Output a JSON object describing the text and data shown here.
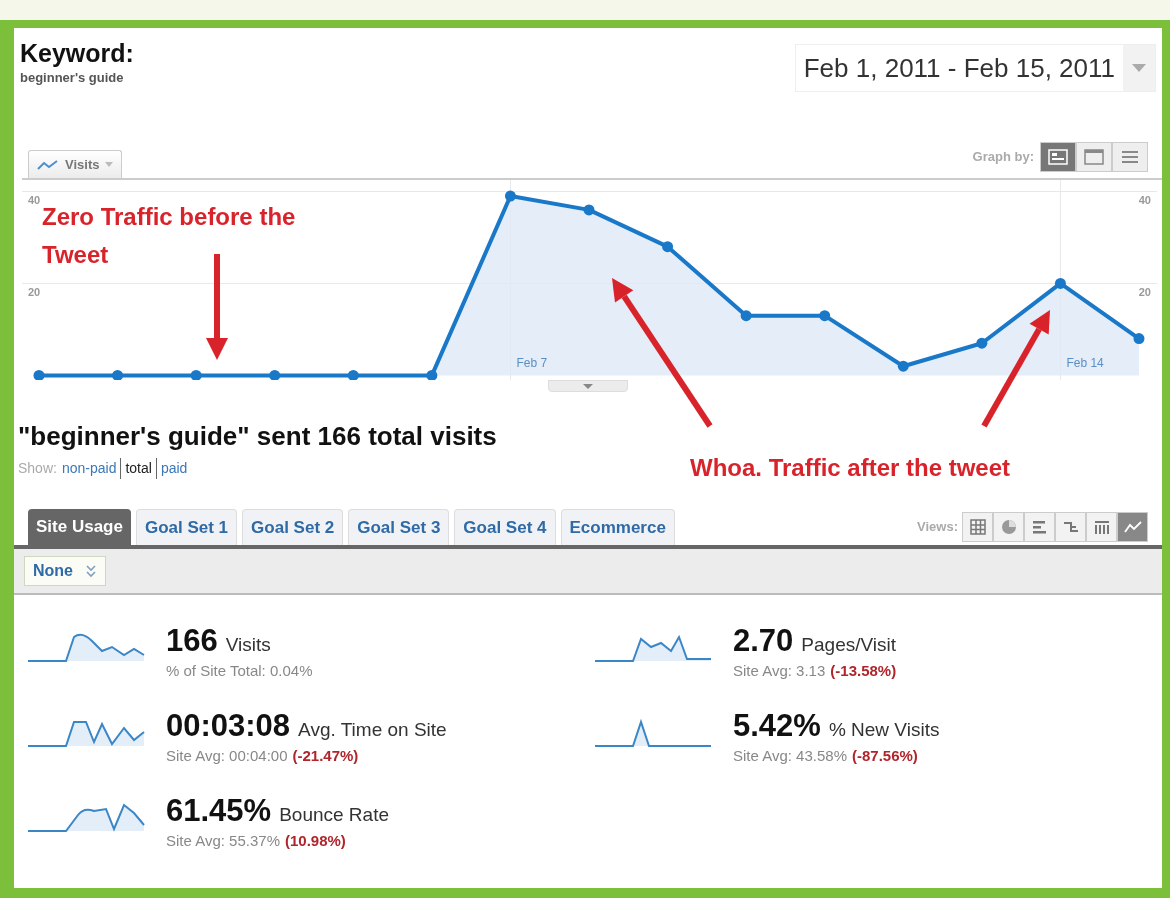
{
  "header": {
    "title": "Keyword:",
    "subtitle": "beginner's guide"
  },
  "date_range": {
    "value": "Feb 1, 2011 - Feb 15, 2011"
  },
  "graph_by": {
    "label": "Graph by:",
    "options": [
      {
        "selected": true
      },
      {
        "selected": false
      },
      {
        "selected": false
      }
    ]
  },
  "chart": {
    "right_axis_ticks": [
      "40",
      "20"
    ],
    "chart_data": {
      "type": "area",
      "categories": [
        null,
        null,
        null,
        null,
        null,
        null,
        "Feb 7",
        null,
        null,
        null,
        null,
        null,
        null,
        "Feb 14",
        null
      ],
      "series": [
        {
          "name": "Visits",
          "color": "#1a78c9",
          "values": [
            0,
            0,
            0,
            0,
            0,
            0,
            39,
            36,
            28,
            13,
            13,
            2,
            7,
            20,
            8
          ]
        }
      ],
      "ylim": [
        -1,
        42.5
      ],
      "yticks": [
        20,
        40
      ]
    }
  },
  "annotations": [
    {
      "text": "Zero Traffic before the Tweet"
    },
    {
      "text": "Whoa. Traffic after the tweet"
    }
  ],
  "summary": {
    "title": "\"beginner's guide\" sent 166 total visits",
    "show_label": "Show:",
    "options": [
      {
        "label": "non-paid",
        "selected": false
      },
      {
        "label": "total",
        "selected": true
      },
      {
        "label": "paid",
        "selected": false
      }
    ]
  },
  "tabs": [
    {
      "label": "Site Usage",
      "selected": true
    },
    {
      "label": "Goal Set 1",
      "selected": false
    },
    {
      "label": "Goal Set 2",
      "selected": false
    },
    {
      "label": "Goal Set 3",
      "selected": false
    },
    {
      "label": "Goal Set 4",
      "selected": false
    },
    {
      "label": "Ecommerce",
      "selected": false
    }
  ],
  "views": {
    "label": "Views:",
    "options": [
      {
        "selected": false
      },
      {
        "selected": false
      },
      {
        "selected": false
      },
      {
        "selected": false
      },
      {
        "selected": false
      },
      {
        "selected": true
      }
    ]
  },
  "segment": {
    "value": "None"
  },
  "metrics": [
    {
      "value": "166",
      "label": "Visits",
      "note": "% of Site Total: 0.04%"
    },
    {
      "value": "2.70",
      "label": "Pages/Visit",
      "note": "Site Avg: 3.13",
      "change": "(-13.58%)"
    },
    {
      "value": "00:03:08",
      "label": "Avg. Time on Site",
      "note": "Site Avg: 00:04:00",
      "change": "(-21.47%)"
    },
    {
      "value": "5.42%",
      "label": "% New Visits",
      "note": "Site Avg: 43.58%",
      "change": "(-87.56%)"
    },
    {
      "value": "61.45%",
      "label": "Bounce Rate",
      "note": "Site Avg: 55.37%",
      "change": "(10.98%)"
    }
  ]
}
